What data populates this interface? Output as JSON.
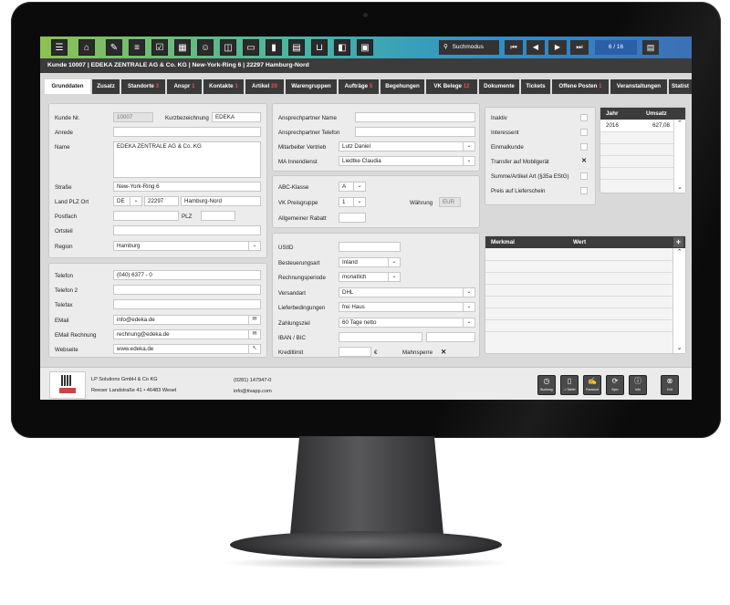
{
  "header": {
    "title": "Kunde 10007 | EDEKA ZENTRALE AG & Co. KG | New-York-Ring 6 | 22297 Hamburg-Nord",
    "search_label": "Suchmodus",
    "pager": "6 / 16"
  },
  "toolbar_icons": [
    "menu-icon",
    "home-icon",
    "wrench-icon",
    "coins-icon",
    "checkbox-icon",
    "calendar-icon",
    "people-icon",
    "box-icon",
    "inbox-icon",
    "fire-extinguisher-icon",
    "stamp-icon",
    "basket-icon",
    "gallery-icon"
  ],
  "tabs": [
    {
      "label": "Grunddaten",
      "count": ""
    },
    {
      "label": "Zusatz",
      "count": ""
    },
    {
      "label": "Standorte",
      "count": "3"
    },
    {
      "label": "Anspr",
      "count": "1"
    },
    {
      "label": "Kontakte",
      "count": "1"
    },
    {
      "label": "Artikel",
      "count": "20"
    },
    {
      "label": "Warengruppen",
      "count": ""
    },
    {
      "label": "Aufträge",
      "count": "5"
    },
    {
      "label": "Begehungen",
      "count": ""
    },
    {
      "label": "VK Belege",
      "count": "12"
    },
    {
      "label": "Dokumente",
      "count": ""
    },
    {
      "label": "Tickets",
      "count": ""
    },
    {
      "label": "Offene Posten",
      "count": "1"
    },
    {
      "label": "Veranstaltungen",
      "count": ""
    },
    {
      "label": "Statist",
      "count": ""
    }
  ],
  "customer": {
    "kunde_nr_label": "Kunde Nr.",
    "kunde_nr": "10007",
    "kurz_label": "Kurzbezeichnung",
    "kurz": "EDEKA",
    "anrede_label": "Anrede",
    "anrede": "",
    "name_label": "Name",
    "name": "EDEKA ZENTRALE AG & Co. KG",
    "strasse_label": "Straße",
    "strasse": "New-York-Ring 6",
    "land_label": "Land PLZ Ort",
    "land": "DE",
    "plz": "22297",
    "ort": "Hamburg-Nord",
    "postfach_label": "Postfach",
    "postfach": "",
    "plz2_label": "PLZ",
    "plz2": "",
    "ortsteil_label": "Ortsteil",
    "ortsteil": "",
    "region_label": "Region",
    "region": "Hamburg"
  },
  "contact": {
    "telefon_label": "Telefon",
    "telefon": "(040) 6377 - 0",
    "telefon2_label": "Telefon 2",
    "telefon2": "",
    "telefax_label": "Telefax",
    "telefax": "",
    "email_label": "EMail",
    "email": "info@edeka.de",
    "email_rechnung_label": "EMail Rechnung",
    "email_rechnung": "rechnung@edeka.de",
    "webseite_label": "Webseite",
    "webseite": "www.edeka.de"
  },
  "ansprech": {
    "name_label": "Ansprechpartner Name",
    "name": "",
    "tel_label": "Ansprechpartner Telefon",
    "tel": "",
    "vertrieb_label": "Mitarbeiter Vertrieb",
    "vertrieb": "Lutz Daniel",
    "innendienst_label": "MA Innendienst",
    "innendienst": "Liedtke Claudia"
  },
  "pricing": {
    "abc_label": "ABC-Klasse",
    "abc": "A",
    "vk_label": "VK Preisgruppe",
    "vk": "1",
    "waehrung_label": "Währung",
    "waehrung": "EUR",
    "rabatt_label": "Allgemeiner Rabatt",
    "rabatt": ""
  },
  "tax": {
    "ustid_label": "UStID",
    "ustid": "",
    "besteuerung_label": "Besteuerungsart",
    "besteuerung": "Inland",
    "periode_label": "Rechnungsperiode",
    "periode": "monatlich",
    "versandart_label": "Versandart",
    "versandart": "DHL",
    "liefer_label": "Lieferbedingungen",
    "liefer": "frei Haus",
    "zahlungsziel_label": "Zahlungsziel",
    "zahlungsziel": "60 Tage netto",
    "iban_label": "IBAN / BIC",
    "iban": "",
    "bic": "",
    "kreditlimit_label": "Kreditlimit",
    "kreditlimit": "",
    "currency_symbol": "€",
    "mahnsperre_label": "Mahnsperre",
    "mahnsperre_mark": "✕"
  },
  "flags": [
    {
      "label": "Inaktiv",
      "checked": false
    },
    {
      "label": "Interessent",
      "checked": false
    },
    {
      "label": "Einmalkunde",
      "checked": false
    },
    {
      "label": "Transfer auf Mobilgerät",
      "checked": true
    },
    {
      "label": "Summe/Artikel Art (§35a EStG)",
      "checked": false
    },
    {
      "label": "Preis auf Lieferschein",
      "checked": false
    }
  ],
  "check_mark": "✕",
  "umsatz": {
    "col_jahr": "Jahr",
    "col_umsatz": "Umsatz",
    "rows": [
      {
        "jahr": "2016",
        "umsatz": "627,08"
      }
    ]
  },
  "merkmal": {
    "col_merkmal": "Merkmal",
    "col_wert": "Wert",
    "add": "+"
  },
  "footer": {
    "company": "LP Solutions GmbH & Co KG",
    "address": "Reeser Landstraße 41 • 46483 Wesel",
    "phone": "(0281) 147947-0",
    "email": "info@tivapp.com",
    "buttons": [
      {
        "label": "Buchung",
        "icon": "stopwatch-icon"
      },
      {
        "label": "-> Tablet",
        "icon": "tablet-icon"
      },
      {
        "label": "Passwort",
        "icon": "signature-icon"
      },
      {
        "label": "Sync",
        "icon": "sync-icon"
      },
      {
        "label": "Info",
        "icon": "info-icon"
      },
      {
        "label": "Exit",
        "icon": "exit-icon"
      }
    ]
  }
}
